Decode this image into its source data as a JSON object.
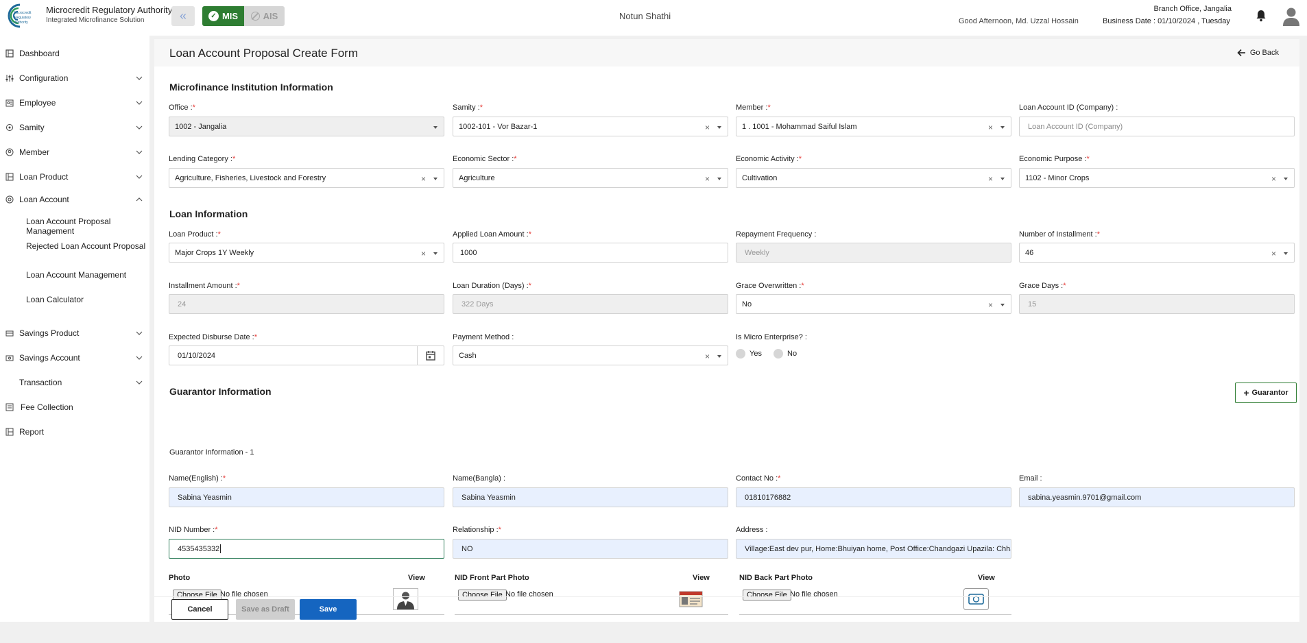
{
  "header": {
    "org_name": "Microcredit Regulatory Authority",
    "org_sub": "Integrated Microfinance Solution",
    "logo_text": "Microcredit Regulatory Authority",
    "mode_mis": "MIS",
    "mode_ais": "AIS",
    "app_title": "Notun Shathi",
    "greeting": "Good Afternoon, Md. Uzzal Hossain",
    "branch": "Branch Office, Jangalia",
    "business_date": "Business Date : 01/10/2024 , Tuesday"
  },
  "sidebar": {
    "items": [
      {
        "label": "Dashboard",
        "icon": "dashboard-icon"
      },
      {
        "label": "Configuration",
        "icon": "sliders-icon"
      },
      {
        "label": "Employee",
        "icon": "employee-icon"
      },
      {
        "label": "Samity",
        "icon": "samity-icon"
      },
      {
        "label": "Member",
        "icon": "member-icon"
      },
      {
        "label": "Loan Product",
        "icon": "loan-product-icon"
      },
      {
        "label": "Loan Account",
        "icon": "loan-account-icon"
      },
      {
        "label": "Savings Product",
        "icon": "savings-product-icon"
      },
      {
        "label": "Savings Account",
        "icon": "savings-account-icon"
      },
      {
        "label": "Transaction",
        "icon": "transaction-icon"
      },
      {
        "label": "Fee Collection",
        "icon": "fee-icon"
      },
      {
        "label": "Report",
        "icon": "report-icon"
      }
    ],
    "loan_account_sub": [
      "Loan Account Proposal Management",
      "Rejected Loan Account Proposal",
      "Loan Account Management",
      "Loan Calculator"
    ]
  },
  "page": {
    "title": "Loan Account Proposal Create Form",
    "go_back": "Go Back"
  },
  "mfi": {
    "section_title": "Microfinance Institution Information",
    "office_label": "Office :",
    "office_value": "1002 - Jangalia",
    "samity_label": "Samity :",
    "samity_value": "1002-101 - Vor Bazar-1",
    "member_label": "Member :",
    "member_value": "1 . 1001 - Mohammad Saiful Islam",
    "loan_account_id_label": "Loan Account ID (Company) :",
    "loan_account_id_placeholder": "Loan Account ID (Company)",
    "lending_category_label": "Lending Category :",
    "lending_category_value": "Agriculture, Fisheries, Livestock and Forestry",
    "economic_sector_label": "Economic Sector :",
    "economic_sector_value": "Agriculture",
    "economic_activity_label": "Economic Activity :",
    "economic_activity_value": "Cultivation",
    "economic_purpose_label": "Economic Purpose :",
    "economic_purpose_value": "1102 - Minor Crops"
  },
  "loan": {
    "section_title": "Loan Information",
    "loan_product_label": "Loan Product :",
    "loan_product_value": "Major Crops 1Y Weekly",
    "applied_amount_label": "Applied Loan Amount :",
    "applied_amount_value": "1000",
    "repayment_frequency_label": "Repayment Frequency :",
    "repayment_frequency_value": "Weekly",
    "installments_label": "Number of Installment :",
    "installments_value": "46",
    "installment_amount_label": "Installment Amount :",
    "installment_amount_value": "24",
    "loan_duration_label": "Loan Duration (Days) :",
    "loan_duration_value": "322 Days",
    "grace_overwritten_label": "Grace Overwritten :",
    "grace_overwritten_value": "No",
    "grace_days_label": "Grace Days :",
    "grace_days_value": "15",
    "disburse_date_label": "Expected Disburse Date :",
    "disburse_date_value": "01/10/2024",
    "payment_method_label": "Payment Method :",
    "payment_method_value": "Cash",
    "micro_enterprise_label": "Is Micro Enterprise? :",
    "yes_label": "Yes",
    "no_label": "No"
  },
  "guarantor": {
    "section_title": "Guarantor Information",
    "add_button": "Guarantor",
    "sub_title": "Guarantor Information - 1",
    "name_en_label": "Name(English) :",
    "name_en_value": "Sabina Yeasmin",
    "name_bn_label": "Name(Bangla) :",
    "name_bn_value": "Sabina Yeasmin",
    "contact_label": "Contact No :",
    "contact_value": "01810176882",
    "email_label": "Email :",
    "email_value": "sabina.yeasmin.9701@gmail.com",
    "nid_label": "NID Number :",
    "nid_value": "4535435332",
    "relationship_label": "Relationship :",
    "relationship_value": "NO",
    "address_label": "Address :",
    "address_value": "Village:East dev pur, Home:Bhuiyan home, Post Office:Chandgazi Upazila: Chhaga",
    "photo_label": "Photo",
    "nid_front_label": "NID Front Part Photo",
    "nid_back_label": "NID Back Part Photo",
    "view_label": "View",
    "choose_file": "Choose File",
    "no_file": "No file chosen"
  },
  "actions": {
    "cancel": "Cancel",
    "save_draft": "Save as Draft",
    "save": "Save"
  }
}
